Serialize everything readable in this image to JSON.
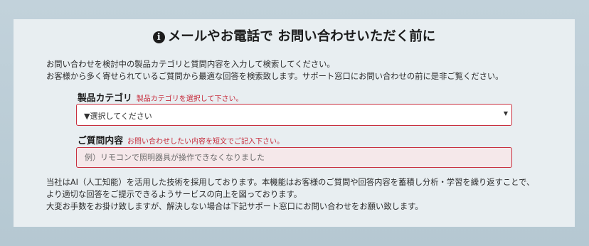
{
  "title": {
    "icon": "info-circle-icon",
    "text": "メールやお電話で お問い合わせいただく前に"
  },
  "intro": [
    "お問い合わせを検討中の製品カテゴリと質問内容を入力して検索してください。",
    "お客様から多く寄せられているご質問から最適な回答を検索致します。サポート窓口にお問い合わせの前に是非ご覧ください。"
  ],
  "product_category": {
    "label": "製品カテゴリ",
    "hint": "製品カテゴリを選択して下さい。",
    "selected": "▼選択してください",
    "caret": "▼"
  },
  "question": {
    "label": "ご質問内容",
    "hint": "お問い合わせしたい内容を短文でご記入下さい。",
    "placeholder": "例）リモコンで照明器具が操作できなくなりました",
    "value": ""
  },
  "footer": [
    "当社はAI（人工知能）を活用した技術を採用しております。本機能はお客様のご質問や回答内容を蓄積し分析・学習を繰り返すことで、",
    "より適切な回答をご提示できるようサービスの向上を図っております。",
    "大変お手数をお掛け致しますが、解決しない場合は下記サポート窓口にお問い合わせをお願い致します。"
  ],
  "colors": {
    "background": "#bccdd6",
    "panel": "#e8eef1",
    "accent_red": "#c8303f",
    "input_fill": "#f5e8ea"
  }
}
